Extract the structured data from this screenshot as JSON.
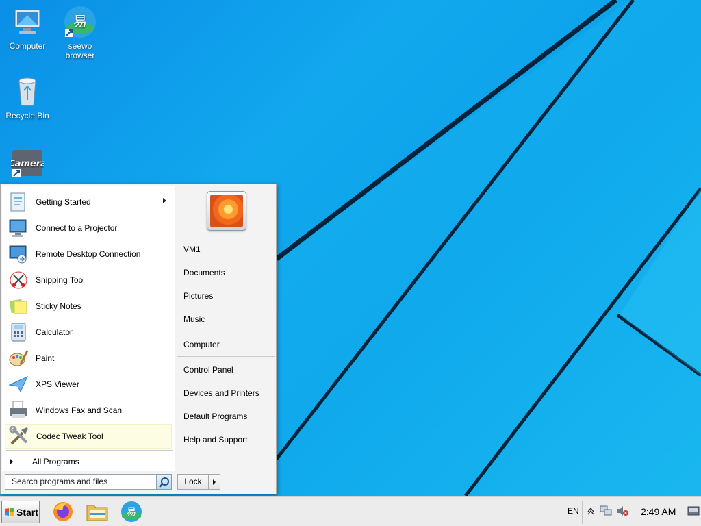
{
  "desktop": {
    "icons": [
      {
        "label": "Computer",
        "icon": "computer-icon"
      },
      {
        "label": "seewo browser",
        "icon": "seewo-browser-icon"
      },
      {
        "label": "Recycle Bin",
        "icon": "recycle-bin-icon"
      },
      {
        "label": "Camera",
        "icon": "camera-icon"
      }
    ]
  },
  "start_menu": {
    "programs": [
      {
        "label": "Getting Started",
        "icon": "getting-started-icon",
        "has_submenu": true
      },
      {
        "label": "Connect to a Projector",
        "icon": "projector-icon"
      },
      {
        "label": "Remote Desktop Connection",
        "icon": "remote-desktop-icon"
      },
      {
        "label": "Snipping Tool",
        "icon": "snipping-tool-icon"
      },
      {
        "label": "Sticky Notes",
        "icon": "sticky-notes-icon"
      },
      {
        "label": "Calculator",
        "icon": "calculator-icon"
      },
      {
        "label": "Paint",
        "icon": "paint-icon"
      },
      {
        "label": "XPS Viewer",
        "icon": "xps-viewer-icon"
      },
      {
        "label": "Windows Fax and Scan",
        "icon": "fax-scan-icon"
      },
      {
        "label": "Codec Tweak Tool",
        "icon": "codec-tweak-icon",
        "highlighted": true
      }
    ],
    "all_programs": "All Programs",
    "search_placeholder": "Search programs and files",
    "right_links": {
      "user": "VM1",
      "documents": "Documents",
      "pictures": "Pictures",
      "music": "Music",
      "computer": "Computer",
      "control_panel": "Control Panel",
      "devices_printers": "Devices and Printers",
      "default_programs": "Default Programs",
      "help_support": "Help and Support"
    },
    "lock_label": "Lock"
  },
  "taskbar": {
    "start_label": "Start",
    "pinned": [
      "firefox-icon",
      "file-explorer-icon",
      "seewo-browser-icon"
    ],
    "language": "EN",
    "clock": "2:49 AM",
    "tray_icons": [
      "show-hidden-icons-icon",
      "network-icon",
      "volume-muted-icon",
      "action-center-icon"
    ]
  }
}
